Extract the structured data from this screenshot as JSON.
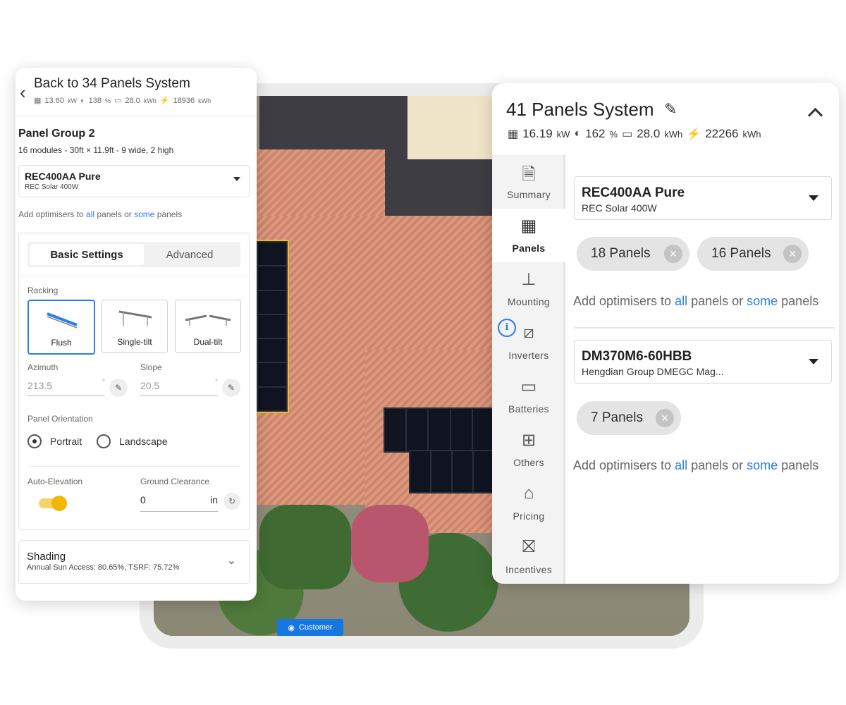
{
  "left_panel": {
    "back_title": "Back to 34 Panels System",
    "stats": {
      "power": "13.60",
      "power_unit": "kW",
      "offset": "138",
      "offset_unit": "%",
      "storage": "28.0",
      "storage_unit": "kWh",
      "production": "18936",
      "production_unit": "kWh"
    },
    "group_title": "Panel Group 2",
    "group_sub": "16 modules - 30ft × 11.9ft - 9 wide, 2 high",
    "module": {
      "name": "REC400AA Pure",
      "sub": "REC Solar 400W"
    },
    "optimisers": {
      "prefix": "Add optimisers to ",
      "all": "all",
      "middle": " panels or ",
      "some": "some",
      "suffix": " panels"
    },
    "tabs": {
      "basic": "Basic Settings",
      "advanced": "Advanced"
    },
    "racking_label": "Racking",
    "racking": [
      "Flush",
      "Single-tilt",
      "Dual-tilt"
    ],
    "racking_selected": "Flush",
    "azimuth": {
      "label": "Azimuth",
      "value": "213.5",
      "unit": "°"
    },
    "slope": {
      "label": "Slope",
      "value": "20.5",
      "unit": "°"
    },
    "orientation": {
      "label": "Panel Orientation",
      "portrait": "Portrait",
      "landscape": "Landscape",
      "selected": "Portrait"
    },
    "auto_elevation": {
      "label": "Auto-Elevation",
      "on": true
    },
    "ground_clearance": {
      "label": "Ground Clearance",
      "value": "0",
      "unit": "in"
    },
    "shading": {
      "title": "Shading",
      "sub": "Annual Sun Access: 80.65%, TSRF: 75.72%"
    }
  },
  "map": {
    "customer_btn": "Customer"
  },
  "right_panel": {
    "title": "41 Panels System",
    "stats": {
      "power": "16.19",
      "power_unit": "kW",
      "offset": "162",
      "offset_unit": "%",
      "storage": "28.0",
      "storage_unit": "kWh",
      "production": "22266",
      "production_unit": "kWh"
    },
    "nav": [
      {
        "label": "Summary",
        "icon": "document-icon",
        "glyph": "🗎"
      },
      {
        "label": "Panels",
        "icon": "grid-icon",
        "glyph": "▦"
      },
      {
        "label": "Mounting",
        "icon": "mounting-icon",
        "glyph": "⊥"
      },
      {
        "label": "Inverters",
        "icon": "inverter-icon",
        "glyph": "⧄"
      },
      {
        "label": "Batteries",
        "icon": "battery-icon",
        "glyph": "▭"
      },
      {
        "label": "Others",
        "icon": "apps-icon",
        "glyph": "⊞"
      },
      {
        "label": "Pricing",
        "icon": "tag-icon",
        "glyph": "⌂"
      },
      {
        "label": "Incentives",
        "icon": "gift-icon",
        "glyph": "⛝"
      }
    ],
    "active_nav": "Panels",
    "module1": {
      "name": "REC400AA Pure",
      "sub": "REC Solar 400W"
    },
    "chips1": [
      "18 Panels",
      "16 Panels"
    ],
    "module2": {
      "name": "DM370M6-60HBB",
      "sub": "Hengdian Group DMEGC Mag..."
    },
    "chips2": [
      "7 Panels"
    ],
    "optimisers": {
      "prefix": "Add optimisers to ",
      "all": "all",
      "middle": " panels or ",
      "some": "some",
      "suffix": " panels"
    }
  },
  "colors": {
    "accent": "#2b7de9",
    "toggle": "#f2b705",
    "customer_btn": "#1677e3"
  }
}
